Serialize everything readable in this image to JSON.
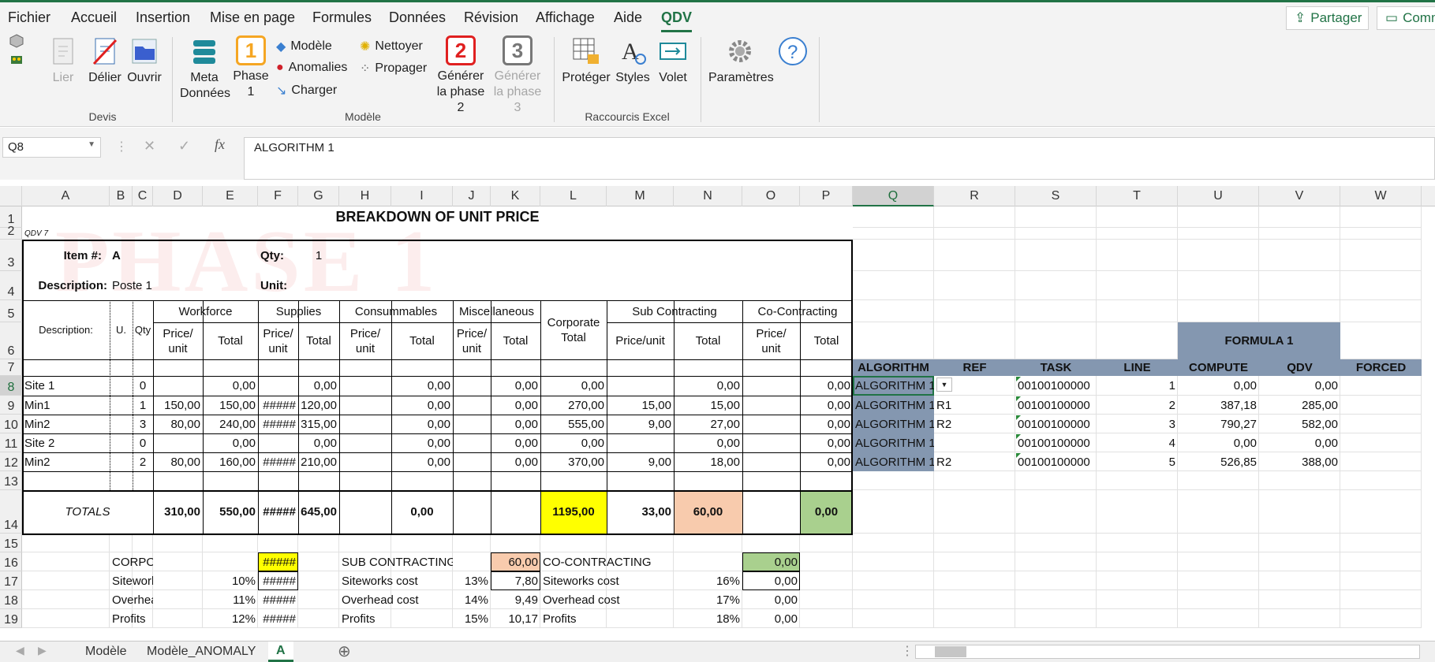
{
  "ribbon_tabs": [
    "Fichier",
    "Accueil",
    "Insertion",
    "Mise en page",
    "Formules",
    "Données",
    "Révision",
    "Affichage",
    "Aide",
    "QDV"
  ],
  "active_tab": "QDV",
  "share_label": "Partager",
  "comments_label": "Comm",
  "ribbon": {
    "devis": {
      "lier": "Lier",
      "delier": "Délier",
      "ouvrir": "Ouvrir",
      "group": "Devis"
    },
    "modele": {
      "meta_l1": "Meta",
      "meta_l2": "Données",
      "phase_num": "1",
      "phase_l1": "Phase",
      "phase_l2": "1",
      "modele": "Modèle",
      "anomalies": "Anomalies",
      "charger": "Charger",
      "nettoyer": "Nettoyer",
      "propager": "Propager",
      "gen2_num": "2",
      "gen2_l1": "Générer",
      "gen2_l2": "la phase 2",
      "gen3_num": "3",
      "gen3_l1": "Générer",
      "gen3_l2": "la phase 3",
      "group": "Modèle"
    },
    "raccourcis": {
      "proteger": "Protéger",
      "styles": "Styles",
      "volet": "Volet",
      "group": "Raccourcis Excel"
    },
    "parametres": "Paramètres"
  },
  "name_box": "Q8",
  "formula": "ALGORITHM 1",
  "columns": [
    "A",
    "B",
    "C",
    "D",
    "E",
    "F",
    "G",
    "H",
    "I",
    "J",
    "K",
    "L",
    "M",
    "N",
    "O",
    "P",
    "Q",
    "R",
    "S",
    "T",
    "U",
    "V",
    "W"
  ],
  "rows": [
    "1",
    "2",
    "3",
    "4",
    "5",
    "6",
    "7",
    "8",
    "9",
    "10",
    "11",
    "12",
    "13",
    "14",
    "15",
    "16",
    "17",
    "18",
    "19"
  ],
  "sheet": {
    "title": "BREAKDOWN OF UNIT PRICE",
    "qdv_tag": "QDV 7",
    "watermark": "PHASE 1",
    "item_label": "Item #:",
    "item_value": "A",
    "qty_label": "Qty:",
    "qty_value": "1",
    "desc_label": "Description:",
    "desc_value": "Poste 1",
    "unit_label": "Unit:",
    "hdr_description": "Description:",
    "hdr_u": "U.",
    "hdr_qty": "Qty",
    "hdr_workforce": "Workforce",
    "hdr_supplies": "Supplies",
    "hdr_consummables": "Consummables",
    "hdr_misc": "Miscellaneous",
    "hdr_corporate_l1": "Corporate",
    "hdr_corporate_l2": "Total",
    "hdr_sub": "Sub Contracting",
    "hdr_co": "Co-Contracting",
    "hdr_price_l1": "Price/",
    "hdr_price_l2": "unit",
    "hdr_total": "Total",
    "hdr_priceunit": "Price/unit",
    "lines": [
      {
        "desc": "Site 1",
        "qty": "0",
        "d": "",
        "e": "0,00",
        "f": "",
        "g": "0,00",
        "h": "",
        "i": "0,00",
        "j": "",
        "k": "0,00",
        "l": "0,00",
        "m": "",
        "n": "0,00",
        "o": "",
        "p": "0,00"
      },
      {
        "desc": "Min1",
        "qty": "1",
        "d": "150,00",
        "e": "150,00",
        "f": "#####",
        "g": "120,00",
        "h": "",
        "i": "0,00",
        "j": "",
        "k": "0,00",
        "l": "270,00",
        "m": "15,00",
        "n": "15,00",
        "o": "",
        "p": "0,00"
      },
      {
        "desc": "Min2",
        "qty": "3",
        "d": "80,00",
        "e": "240,00",
        "f": "#####",
        "g": "315,00",
        "h": "",
        "i": "0,00",
        "j": "",
        "k": "0,00",
        "l": "555,00",
        "m": "9,00",
        "n": "27,00",
        "o": "",
        "p": "0,00"
      },
      {
        "desc": "Site 2",
        "qty": "0",
        "d": "",
        "e": "0,00",
        "f": "",
        "g": "0,00",
        "h": "",
        "i": "0,00",
        "j": "",
        "k": "0,00",
        "l": "0,00",
        "m": "",
        "n": "0,00",
        "o": "",
        "p": "0,00"
      },
      {
        "desc": "Min2",
        "qty": "2",
        "d": "80,00",
        "e": "160,00",
        "f": "#####",
        "g": "210,00",
        "h": "",
        "i": "0,00",
        "j": "",
        "k": "0,00",
        "l": "370,00",
        "m": "9,00",
        "n": "18,00",
        "o": "",
        "p": "0,00"
      }
    ],
    "totals": {
      "label": "TOTALS",
      "d": "310,00",
      "e": "550,00",
      "f": "#####",
      "g": "645,00",
      "i": "0,00",
      "l": "1195,00",
      "m": "33,00",
      "n": "60,00",
      "p": "0,00"
    },
    "corporate": {
      "title": "CORPORATE",
      "total": "#####",
      "siteworks": "Siteworks cost",
      "siteworks_pct": "10%",
      "siteworks_val": "#####",
      "overhead": "Overhead cost",
      "overhead_pct": "11%",
      "overhead_val": "#####",
      "profits": "Profits",
      "profits_pct": "12%",
      "profits_val": "#####"
    },
    "subcontracting": {
      "title": "SUB CONTRACTING",
      "total": "60,00",
      "siteworks": "Siteworks cost",
      "siteworks_pct": "13%",
      "siteworks_val": "7,80",
      "overhead": "Overhead cost",
      "overhead_pct": "14%",
      "overhead_val": "9,49",
      "profits": "Profits",
      "profits_pct": "15%",
      "profits_val": "10,17"
    },
    "cocontracting": {
      "title": "CO-CONTRACTING",
      "total": "0,00",
      "siteworks": "Siteworks cost",
      "siteworks_pct": "16%",
      "siteworks_val": "0,00",
      "overhead": "Overhead cost",
      "overhead_pct": "17%",
      "overhead_val": "0,00",
      "profits": "Profits",
      "profits_pct": "18%",
      "profits_val": "0,00"
    },
    "formula_header": "FORMULA 1",
    "algo_headers": {
      "algorithm": "ALGORITHM",
      "ref": "REF",
      "task": "TASK",
      "line": "LINE",
      "compute": "COMPUTE",
      "qdv": "QDV",
      "forced": "FORCED"
    },
    "algo_rows": [
      {
        "algorithm": "ALGORITHM 1",
        "ref": "",
        "task": "00100100000",
        "line": "1",
        "compute": "0,00",
        "qdv": "0,00"
      },
      {
        "algorithm": "ALGORITHM 1",
        "ref": "R1",
        "task": "00100100000",
        "line": "2",
        "compute": "387,18",
        "qdv": "285,00"
      },
      {
        "algorithm": "ALGORITHM 1",
        "ref": "R2",
        "task": "00100100000",
        "line": "3",
        "compute": "790,27",
        "qdv": "582,00"
      },
      {
        "algorithm": "ALGORITHM 1",
        "ref": "",
        "task": "00100100000",
        "line": "4",
        "compute": "0,00",
        "qdv": "0,00"
      },
      {
        "algorithm": "ALGORITHM 1",
        "ref": "R2",
        "task": "00100100000",
        "line": "5",
        "compute": "526,85",
        "qdv": "388,00"
      }
    ]
  },
  "sheet_tabs": [
    "Modèle",
    "Modèle_ANOMALY",
    "A"
  ],
  "active_sheet": "A",
  "colors": {
    "accent": "#217346",
    "yellow": "#ffff00",
    "salmon": "#f8cbad",
    "green": "#a9d08e",
    "slate": "#8497b0"
  }
}
